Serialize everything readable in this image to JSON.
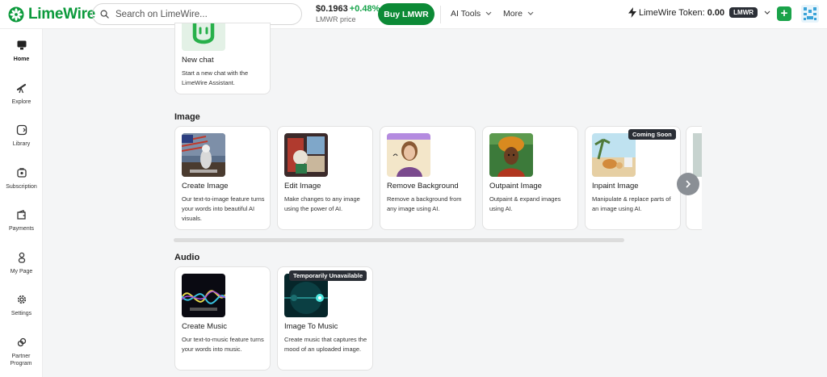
{
  "brand": {
    "name": "LimeWire",
    "color": "#0c9a3c"
  },
  "search": {
    "placeholder": "Search on LimeWire..."
  },
  "price": {
    "value": "$0.1963",
    "change": "+0.48%",
    "label": "LMWR price"
  },
  "header": {
    "buy_label": "Buy LMWR",
    "ai_tools_label": "AI Tools",
    "more_label": "More",
    "token_label": "LimeWire Token:",
    "token_value": "0.00",
    "token_symbol": "LMWR",
    "plus_label": "+"
  },
  "sidebar": {
    "items": [
      {
        "label": "Home",
        "icon": "home-monitor-icon"
      },
      {
        "label": "Explore",
        "icon": "telescope-icon"
      },
      {
        "label": "Library",
        "icon": "library-icon"
      },
      {
        "label": "Subscription",
        "icon": "subscription-icon"
      },
      {
        "label": "Payments",
        "icon": "wallet-icon"
      },
      {
        "label": "My Page",
        "icon": "user-icon"
      },
      {
        "label": "Settings",
        "icon": "gear-icon"
      },
      {
        "label": "Partner Program",
        "icon": "partner-icon"
      }
    ]
  },
  "chat": {
    "title": "New chat",
    "description": "Start a new chat with the LimeWire Assistant."
  },
  "image_section": {
    "title": "Image",
    "cards": [
      {
        "title": "Create Image",
        "description": "Our text-to-image feature turns your words into beautiful AI visuals."
      },
      {
        "title": "Edit Image",
        "description": "Make changes to any image using the power of AI."
      },
      {
        "title": "Remove Background",
        "description": "Remove a background from any image using AI."
      },
      {
        "title": "Outpaint Image",
        "description": "Outpaint & expand images using AI."
      },
      {
        "title": "Inpaint Image",
        "description": "Manipulate & replace parts of an image using AI.",
        "badge": "Coming Soon"
      }
    ]
  },
  "audio_section": {
    "title": "Audio",
    "cards": [
      {
        "title": "Create Music",
        "description": "Our text-to-music feature turns your words into music."
      },
      {
        "title": "Image To Music",
        "description": "Create music that captures the mood of an uploaded image.",
        "badge": "Temporarily Unavailable"
      }
    ]
  },
  "carousel": {
    "next_icon": "chevron-right-icon"
  }
}
